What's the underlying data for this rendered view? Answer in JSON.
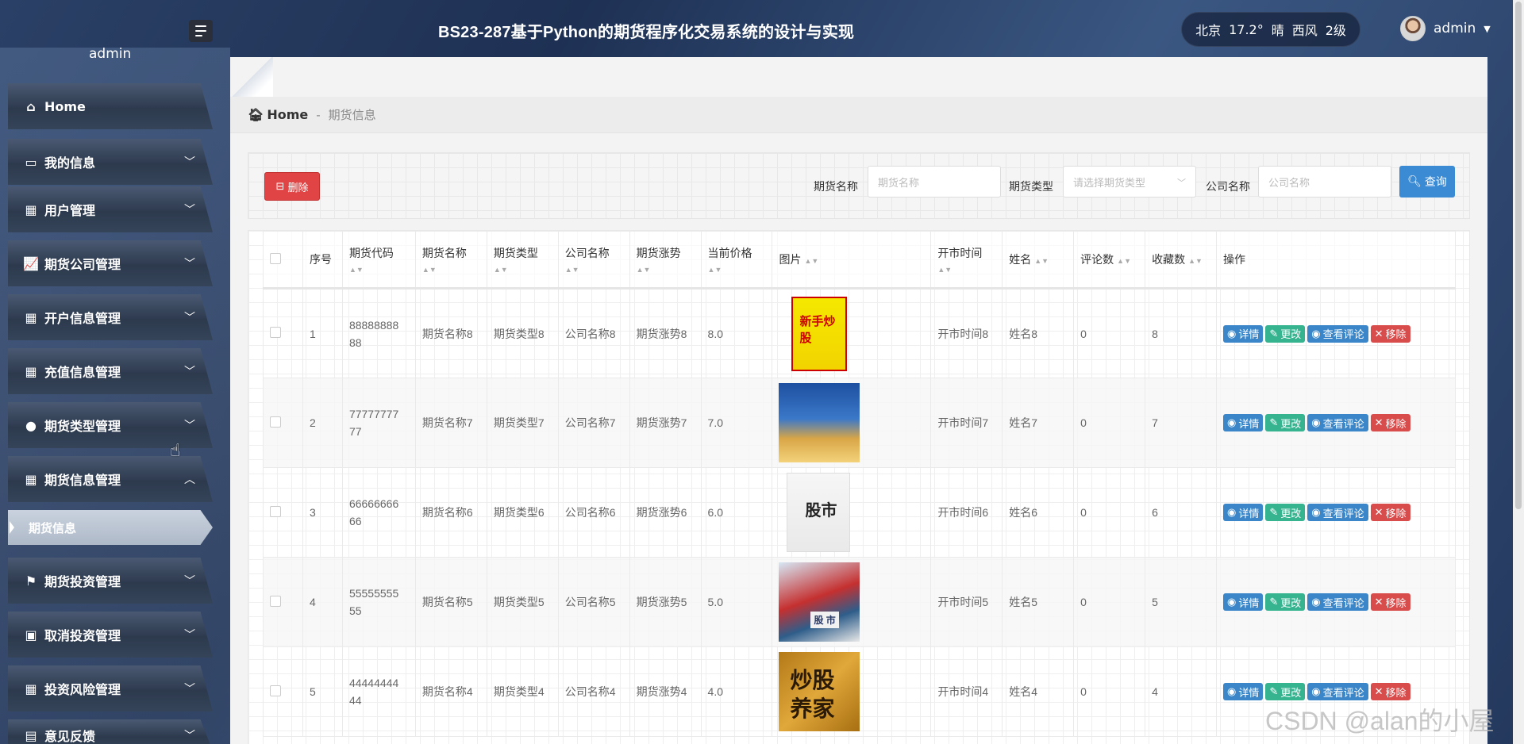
{
  "header": {
    "title": "BS23-287基于Python的期货程序化交易系统的设计与实现",
    "weather": {
      "city": "北京",
      "temp": "17.2°",
      "condition": "晴",
      "wind": "西风",
      "level": "2级"
    },
    "username": "admin"
  },
  "sidebar": {
    "username": "admin",
    "items": [
      {
        "label": "Home",
        "icon": "home-icon"
      },
      {
        "label": "我的信息",
        "icon": "id-card-icon"
      },
      {
        "label": "用户管理",
        "icon": "grid-icon"
      },
      {
        "label": "期货公司管理",
        "icon": "chart-icon"
      },
      {
        "label": "开户信息管理",
        "icon": "grid-icon"
      },
      {
        "label": "充值信息管理",
        "icon": "grid-icon"
      },
      {
        "label": "期货类型管理",
        "icon": "bulb-icon"
      },
      {
        "label": "期货信息管理",
        "icon": "table-icon"
      },
      {
        "label": "期货信息",
        "icon": ""
      },
      {
        "label": "期货投资管理",
        "icon": "flag-icon"
      },
      {
        "label": "取消投资管理",
        "icon": "wallet-icon"
      },
      {
        "label": "投资风险管理",
        "icon": "grid-icon"
      },
      {
        "label": "意见反馈",
        "icon": "clipboard-icon"
      }
    ]
  },
  "breadcrumb": {
    "home": "Home",
    "sep": "-",
    "current": "期货信息"
  },
  "toolbar": {
    "delete_label": "删除",
    "filters": [
      {
        "label": "期货名称",
        "placeholder": "期货名称"
      },
      {
        "label": "期货类型",
        "placeholder": "请选择期货类型"
      },
      {
        "label": "公司名称",
        "placeholder": "公司名称"
      }
    ],
    "query_label": "查询"
  },
  "table": {
    "columns": [
      "序号",
      "期货代码",
      "期货名称",
      "期货类型",
      "公司名称",
      "期货涨势",
      "当前价格",
      "图片",
      "开市时间",
      "姓名",
      "评论数",
      "收藏数",
      "操作"
    ],
    "actions": {
      "detail": "详情",
      "edit": "更改",
      "comments": "查看评论",
      "remove": "移除"
    },
    "rows": [
      {
        "idx": "1",
        "code": "8888888888",
        "name": "期货名称8",
        "type": "期货类型8",
        "company": "公司名称8",
        "trend": "期货涨势8",
        "price": "8.0",
        "img_text": "新手炒股",
        "open": "开市时间8",
        "person": "姓名8",
        "comments": "0",
        "favs": "8"
      },
      {
        "idx": "2",
        "code": "7777777777",
        "name": "期货名称7",
        "type": "期货类型7",
        "company": "公司名称7",
        "trend": "期货涨势7",
        "price": "7.0",
        "img_text": "",
        "open": "开市时间7",
        "person": "姓名7",
        "comments": "0",
        "favs": "7"
      },
      {
        "idx": "3",
        "code": "6666666666",
        "name": "期货名称6",
        "type": "期货类型6",
        "company": "公司名称6",
        "trend": "期货涨势6",
        "price": "6.0",
        "img_text": "股市",
        "open": "开市时间6",
        "person": "姓名6",
        "comments": "0",
        "favs": "6"
      },
      {
        "idx": "4",
        "code": "5555555555",
        "name": "期货名称5",
        "type": "期货类型5",
        "company": "公司名称5",
        "trend": "期货涨势5",
        "price": "5.0",
        "img_text": "股 市",
        "open": "开市时间5",
        "person": "姓名5",
        "comments": "0",
        "favs": "5"
      },
      {
        "idx": "5",
        "code": "4444444444",
        "name": "期货名称4",
        "type": "期货类型4",
        "company": "公司名称4",
        "trend": "期货涨势4",
        "price": "4.0",
        "img_text": "炒股 养家",
        "open": "开市时间4",
        "person": "姓名4",
        "comments": "0",
        "favs": "4"
      }
    ]
  },
  "watermark": "CSDN @alan的小屋"
}
